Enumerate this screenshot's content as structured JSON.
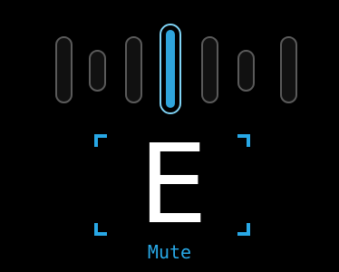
{
  "tuner": {
    "note": "E",
    "status": "Mute",
    "meter": {
      "segment_count": 7,
      "active_segment": 4,
      "active_color": "#2fa5dc",
      "inactive_color": "#5a5a5a"
    },
    "bracket_color": "#28a8e6",
    "background_color": "#000000"
  }
}
